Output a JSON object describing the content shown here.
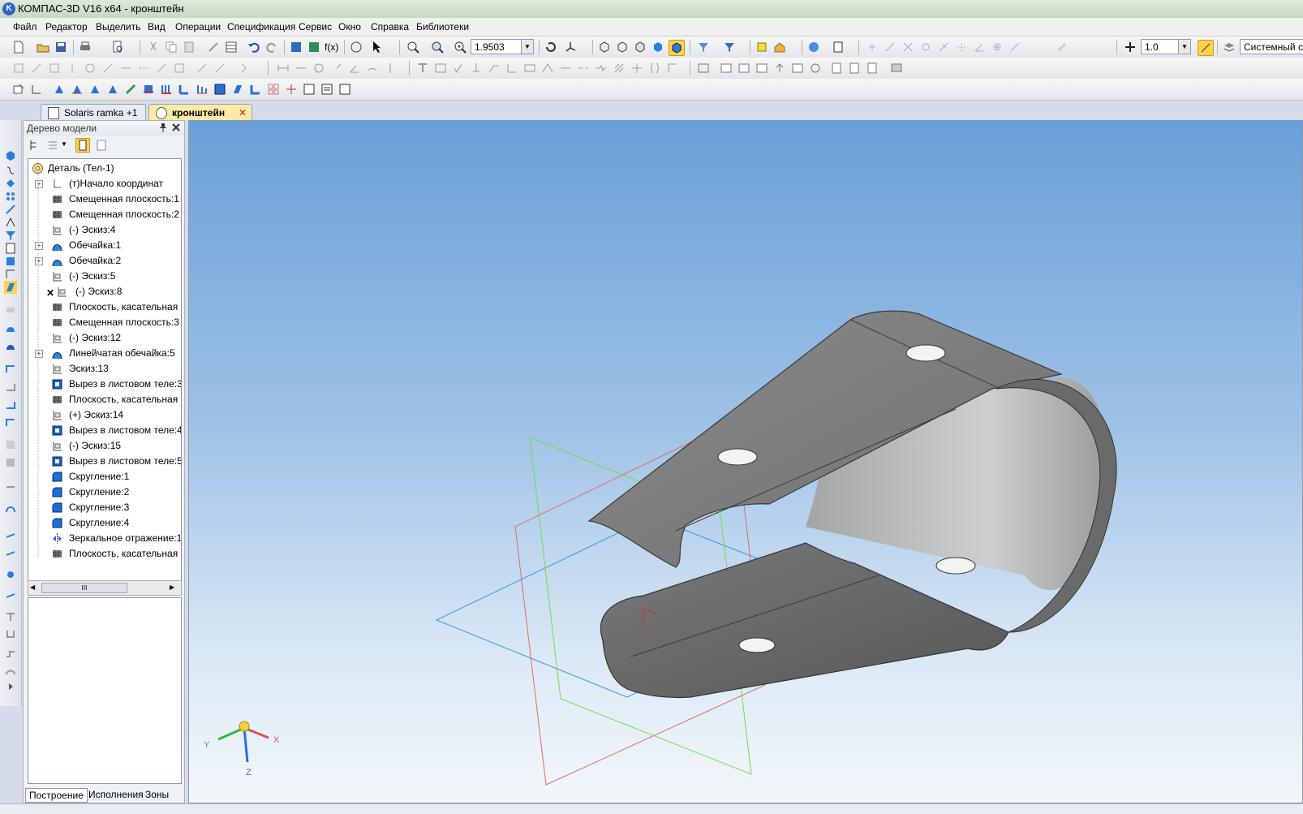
{
  "window": {
    "app_icon": "K",
    "title": "КОМПАС-3D V16  x64 - кронштейн"
  },
  "menu": [
    "Файл",
    "Редактор",
    "Выделить",
    "Вид",
    "Операции",
    "Спецификация",
    "Сервис",
    "Окно",
    "Справка",
    "Библиотеки"
  ],
  "toolbar": {
    "zoom_value": "1.9503",
    "step_value": "1.0",
    "coord_system": "Системный с"
  },
  "doc_tabs": [
    {
      "label": "Solaris ramka +1",
      "active": false
    },
    {
      "label": "кронштейн",
      "active": true,
      "close": "✕"
    }
  ],
  "tree_panel": {
    "title": "Дерево модели",
    "pin_icon": "pin-icon",
    "close_icon": "close-icon",
    "items": [
      {
        "label": "Деталь (Тел-1)",
        "icon": "part-icon",
        "expander": ""
      },
      {
        "label": "(т)Начало координат",
        "icon": "origin-icon",
        "expander": "+"
      },
      {
        "label": "Смещенная плоскость:1",
        "icon": "plane-icon",
        "expander": ""
      },
      {
        "label": "Смещенная плоскость:2",
        "icon": "plane-icon",
        "expander": ""
      },
      {
        "label": "(-) Эскиз:4",
        "icon": "sketch-icon",
        "expander": ""
      },
      {
        "label": "Обечайка:1",
        "icon": "shell-icon",
        "expander": "+"
      },
      {
        "label": "Обечайка:2",
        "icon": "shell-icon",
        "expander": "+"
      },
      {
        "label": "(-) Эскиз:5",
        "icon": "sketch-icon",
        "expander": ""
      },
      {
        "label": "(-) Эскиз:8",
        "icon": "sketch-error-icon",
        "expander": ""
      },
      {
        "label": "Плоскость, касательная к",
        "icon": "plane-icon",
        "expander": ""
      },
      {
        "label": "Смещенная плоскость:3",
        "icon": "plane-icon",
        "expander": ""
      },
      {
        "label": "(-) Эскиз:12",
        "icon": "sketch-icon",
        "expander": ""
      },
      {
        "label": "Линейчатая обечайка:5",
        "icon": "shell-icon",
        "expander": "+"
      },
      {
        "label": "Эскиз:13",
        "icon": "sketch-icon",
        "expander": ""
      },
      {
        "label": "Вырез в листовом теле:3",
        "icon": "cut-icon",
        "expander": ""
      },
      {
        "label": "Плоскость, касательная к",
        "icon": "plane-icon",
        "expander": ""
      },
      {
        "label": "(+) Эскиз:14",
        "icon": "sketch-icon",
        "expander": ""
      },
      {
        "label": "Вырез в листовом теле:4",
        "icon": "cut-icon",
        "expander": ""
      },
      {
        "label": "(-) Эскиз:15",
        "icon": "sketch-icon",
        "expander": ""
      },
      {
        "label": "Вырез в листовом теле:5",
        "icon": "cut-icon",
        "expander": ""
      },
      {
        "label": "Скругление:1",
        "icon": "fillet-icon",
        "expander": ""
      },
      {
        "label": "Скругление:2",
        "icon": "fillet-icon",
        "expander": ""
      },
      {
        "label": "Скругление:3",
        "icon": "fillet-icon",
        "expander": ""
      },
      {
        "label": "Скругление:4",
        "icon": "fillet-icon",
        "expander": ""
      },
      {
        "label": "Зеркальное отражение:1",
        "icon": "mirror-icon",
        "expander": ""
      },
      {
        "label": "Плоскость, касательная к",
        "icon": "plane-icon",
        "expander": ""
      }
    ],
    "scroll_grip": "III",
    "bottom_tabs": [
      "Построение",
      "Исполнения",
      "Зоны"
    ]
  },
  "viewport": {
    "axes": {
      "x": "X",
      "y": "Y",
      "z": "Z"
    },
    "colors": {
      "x_axis": "#d9534f",
      "y_axis": "#3fae49",
      "z_axis": "#2f6fd6",
      "plane_red": "#e06a6a",
      "plane_green": "#7ad84a",
      "plane_blue": "#3a9ad6"
    }
  }
}
